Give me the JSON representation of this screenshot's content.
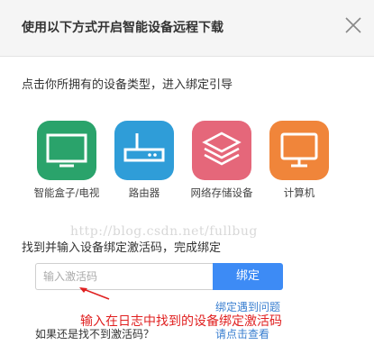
{
  "dialog": {
    "title": "使用以下方式开启智能设备远程下载",
    "close_icon": "close-icon"
  },
  "instruction": "点击你所拥有的设备类型，进入绑定引导",
  "devices": [
    {
      "label": "智能盒子/电视",
      "icon": "tv-icon",
      "color": "#2aa36b"
    },
    {
      "label": "路由器",
      "icon": "router-icon",
      "color": "#2f9dd8"
    },
    {
      "label": "网络存储设备",
      "icon": "storage-icon",
      "color": "#e5677a"
    },
    {
      "label": "计算机",
      "icon": "computer-icon",
      "color": "#f0853a"
    }
  ],
  "watermark": "http://blog.csdn.net/fullbug",
  "activation": {
    "prompt": "找到并输入设备绑定激活码，完成绑定",
    "placeholder": "输入激活码",
    "bind_label": "绑定",
    "problem_link": "绑定遇到问题",
    "annotation": "输入在日志中找到的设备绑定激活码",
    "notfound_text": "如果还是找不到激活码？",
    "click_here_link": "请点击查看"
  }
}
